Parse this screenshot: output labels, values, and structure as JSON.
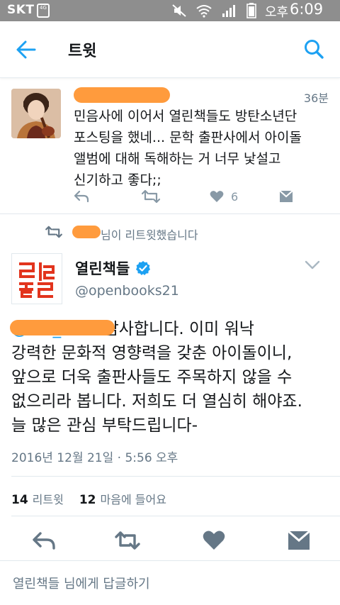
{
  "status_bar": {
    "carrier": "SKT",
    "network_badge": "4G",
    "ampm": "오후",
    "time": "6:09",
    "icons": [
      "mute-icon",
      "wifi-icon",
      "signal-icon",
      "battery-icon"
    ]
  },
  "header": {
    "title": "트윗",
    "back_icon": "arrow-left-icon",
    "search_icon": "search-icon"
  },
  "reply_tweet": {
    "time_ago": "36분",
    "text_lines": [
      "민음사에 이어서 열린책들도 방탄소년단",
      "포스팅을 했네... 문학 출판사에서 아이돌",
      "앨범에 대해 독해하는 거 너무 낯설고",
      "신기하고 좋다;;"
    ],
    "like_count": "6"
  },
  "retweet_notice": {
    "text": "님이 리트윗했습니다"
  },
  "main_tweet": {
    "display_name": "열린책들",
    "handle": "@openbooks21",
    "mention_visible": "@bts_ssam",
    "body_first": "감사합니다. 이미 워낙",
    "body_lines": [
      "강력한 문화적 영향력을 갖춘 아이돌이니,",
      "앞으로 더욱 출판사들도 주목하지 않을 수",
      "없으리라 봅니다. 저희도 더 열심히 해야죠.",
      "늘 많은 관심 부탁드립니다-"
    ],
    "timestamp": "2016년 12월 21일 · 5:56 오후",
    "retweet_count": "14",
    "retweet_label": "리트윗",
    "like_count": "12",
    "like_label": "마음에 들어요"
  },
  "reply_bar": {
    "placeholder": "열린책들 님에게 답글하기"
  },
  "colors": {
    "accent": "#1da1f2",
    "redaction": "#ff9b3d",
    "status_bar": "#8e8e8e",
    "icon_gray": "#8899a6",
    "icon_dark": "#657786",
    "brand_red": "#e2341d"
  }
}
